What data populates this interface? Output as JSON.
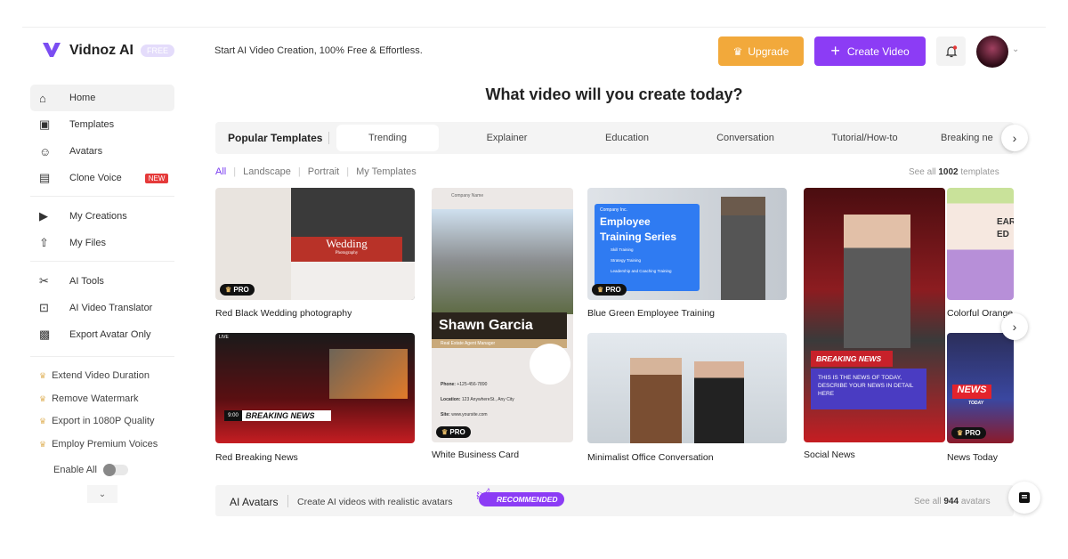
{
  "brand": {
    "name": "Vidnoz AI",
    "badge": "FREE",
    "tagline": "Start AI Video Creation, 100% Free & Effortless."
  },
  "header": {
    "upgrade": "Upgrade",
    "create": "Create Video",
    "bell_icon": "bell-icon",
    "accent": "#8c3cf5",
    "upgrade_color": "#f2a93b"
  },
  "sidebar": {
    "items": [
      {
        "label": "Home",
        "icon": "home-icon"
      },
      {
        "label": "Templates",
        "icon": "templates-icon"
      },
      {
        "label": "Avatars",
        "icon": "avatar-icon"
      },
      {
        "label": "Clone Voice",
        "icon": "voice-icon",
        "badge": "NEW"
      },
      {
        "label": "My Creations",
        "icon": "creations-icon"
      },
      {
        "label": "My Files",
        "icon": "upload-cloud-icon"
      },
      {
        "label": "AI Tools",
        "icon": "tools-icon"
      },
      {
        "label": "AI Video Translator",
        "icon": "translator-icon"
      },
      {
        "label": "Export Avatar Only",
        "icon": "export-avatar-icon"
      }
    ],
    "perks": [
      "Extend Video Duration",
      "Remove Watermark",
      "Export in 1080P Quality",
      "Employ Premium Voices"
    ],
    "enable_all": "Enable All"
  },
  "main": {
    "heading": "What video will you create today?",
    "tabs_label": "Popular Templates",
    "tabs": [
      "Trending",
      "Explainer",
      "Education",
      "Conversation",
      "Tutorial/How-to",
      "Breaking ne"
    ],
    "filters": [
      "All",
      "Landscape",
      "Portrait",
      "My Templates"
    ],
    "see_all": {
      "prefix": "See all",
      "count": "1002",
      "suffix": "templates"
    },
    "pro": "PRO",
    "templates": [
      {
        "title": "Red Black Wedding photography",
        "thumb": {
          "headline": "Wedding",
          "sub": "Photography"
        }
      },
      {
        "title": "Red Breaking News",
        "thumb": {
          "headline": "BREAKING NEWS",
          "time": "9:00",
          "live": "LIVE"
        }
      },
      {
        "title": "White Business Card",
        "thumb": {
          "company": "Company Name",
          "name": "Shawn Garcia",
          "role": "Real Estate Agent Manager",
          "phone_label": "Phone:",
          "phone": "+125-456-7890",
          "location_label": "Location:",
          "location": "123 AnywhereSt., Any City",
          "site_label": "Site:",
          "site": "www.yoursite.com"
        }
      },
      {
        "title": "Blue Green Employee Training",
        "thumb": {
          "company": "Company Inc.",
          "headline": "Employee Training Series",
          "points": [
            "Skill Training",
            "Strategy Training",
            "Leadership and Coaching Training"
          ]
        }
      },
      {
        "title": "Minimalist Office Conversation"
      },
      {
        "title": "Social News",
        "thumb": {
          "headline": "BREAKING NEWS",
          "body": "THIS IS THE  NEWS OF TODAY, DESCRIBE YOUR NEWS IN DETAIL HERE"
        }
      },
      {
        "title": "Colorful Orange",
        "thumb": {
          "headline": "EAR ED"
        }
      },
      {
        "title": "News Today",
        "thumb": {
          "headline": "NEWS",
          "sub": "TODAY"
        }
      }
    ]
  },
  "avatars": {
    "title": "AI Avatars",
    "desc": "Create AI videos with realistic avatars",
    "badge": "RECOMMENDED",
    "see_all": {
      "prefix": "See all",
      "count": "944",
      "suffix": "avatars"
    }
  }
}
